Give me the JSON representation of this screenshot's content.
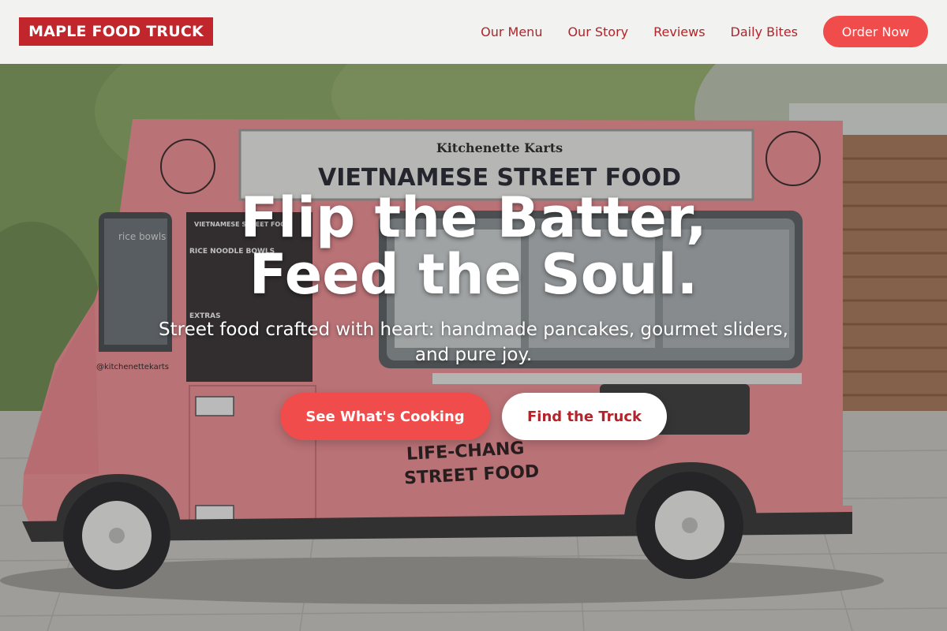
{
  "brand": {
    "logo_text": "MAPLE FOOD TRUCK"
  },
  "nav": {
    "links": [
      "Our Menu",
      "Our Story",
      "Reviews",
      "Daily Bites"
    ],
    "order_label": "Order Now"
  },
  "hero": {
    "title_line1": "Flip the Batter,",
    "title_line2": "Feed the Soul.",
    "subtitle_line1": "Street food crafted with heart: handmade pancakes, gourmet sliders,",
    "subtitle_line2": "and pure joy.",
    "primary_cta": "See What's Cooking",
    "secondary_cta": "Find the Truck"
  },
  "photo": {
    "sign_small": "Kitchenette Karts",
    "sign_main": "VIETNAMESE STREET FOOD",
    "side_line1": "LIFE-CHANG",
    "side_line2": "STREET FOOD",
    "handle": "@kitchenettekarts",
    "menu_heading": "VIETNAMESE STREET FOOD",
    "menu_section1": "RICE NOODLE BOWLS",
    "menu_section2": "EXTRAS",
    "window_text": "rice bowls"
  },
  "colors": {
    "brand_red": "#c0262b",
    "accent_coral": "#f14c4c",
    "nav_text": "#b52229",
    "truck_pink": "#e88d92"
  }
}
